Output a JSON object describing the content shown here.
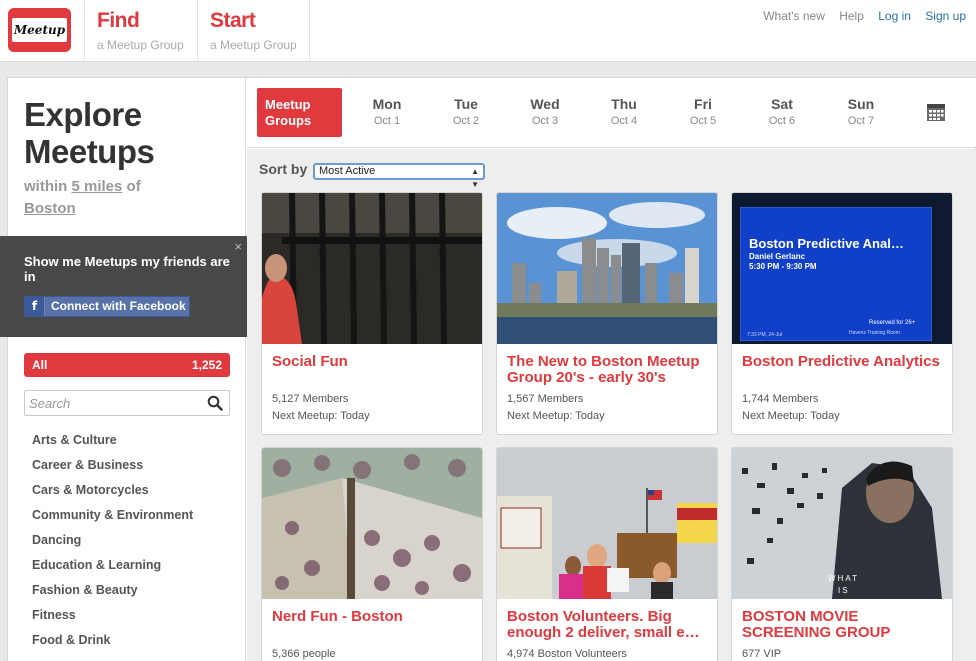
{
  "header": {
    "logo_text": "Meetup",
    "nav": [
      {
        "title": "Find",
        "sub": "a Meetup Group"
      },
      {
        "title": "Start",
        "sub": "a Meetup Group"
      }
    ],
    "links": [
      "What's new",
      "Help",
      "Log in",
      "Sign up"
    ]
  },
  "sidebar": {
    "title_line1": "Explore",
    "title_line2": "Meetups",
    "within_prefix": "within",
    "within_distance": "5 miles",
    "within_of": "of",
    "location": "Boston",
    "fb_prompt": "Show me Meetups my friends are in",
    "fb_close": "×",
    "fb_button": "Connect with Facebook",
    "all_label": "All",
    "all_count": "1,252",
    "search_placeholder": "Search",
    "categories": [
      "Arts & Culture",
      "Career & Business",
      "Cars & Motorcycles",
      "Community & Environment",
      "Dancing",
      "Education & Learning",
      "Fashion & Beauty",
      "Fitness",
      "Food & Drink"
    ]
  },
  "daybar": {
    "groups_button_line1": "Meetup",
    "groups_button_line2": "Groups",
    "days": [
      {
        "name": "Mon",
        "date": "Oct 1"
      },
      {
        "name": "Tue",
        "date": "Oct 2"
      },
      {
        "name": "Wed",
        "date": "Oct 3"
      },
      {
        "name": "Thu",
        "date": "Oct 4"
      },
      {
        "name": "Fri",
        "date": "Oct 5"
      },
      {
        "name": "Sat",
        "date": "Oct 6"
      },
      {
        "name": "Sun",
        "date": "Oct 7"
      }
    ]
  },
  "results": {
    "sort_label": "Sort by",
    "sort_value": "Most Active",
    "cards": [
      {
        "title": "Social Fun",
        "members": "5,127 Members",
        "next": "Next Meetup: Today"
      },
      {
        "title": "The New to Boston Meetup Group 20's - early 30's",
        "members": "1,567 Members",
        "next": "Next Meetup: Today"
      },
      {
        "title": "Boston Predictive Analytics",
        "members": "1,744 Members",
        "next": "Next Meetup: Today",
        "photo_heading": "Boston Predictive Anal…",
        "photo_sub": "Daniel Gerlanc",
        "photo_time": "5:30 PM - 9:30 PM",
        "photo_note": "Reserved for 26+",
        "photo_room": "Havens Training Room",
        "photo_foot": "7:33 PM, 24-Jul"
      },
      {
        "title": "Nerd Fun - Boston",
        "members": "5,366 people",
        "next": ""
      },
      {
        "title": "Boston Volunteers. Big enough 2 deliver, small e…",
        "members": "4,974 Boston Volunteers",
        "next": ""
      },
      {
        "title": "BOSTON MOVIE SCREENING GROUP",
        "members": "677 VIP",
        "next": "",
        "photo_text1": "WHAT",
        "photo_text2": "IS"
      }
    ]
  },
  "colors": {
    "brand": "#e0393e",
    "facebook": "#3b5998",
    "link": "#2a6fb0"
  },
  "icons": [
    "search-icon",
    "calendar-icon",
    "facebook-icon",
    "close-icon"
  ]
}
